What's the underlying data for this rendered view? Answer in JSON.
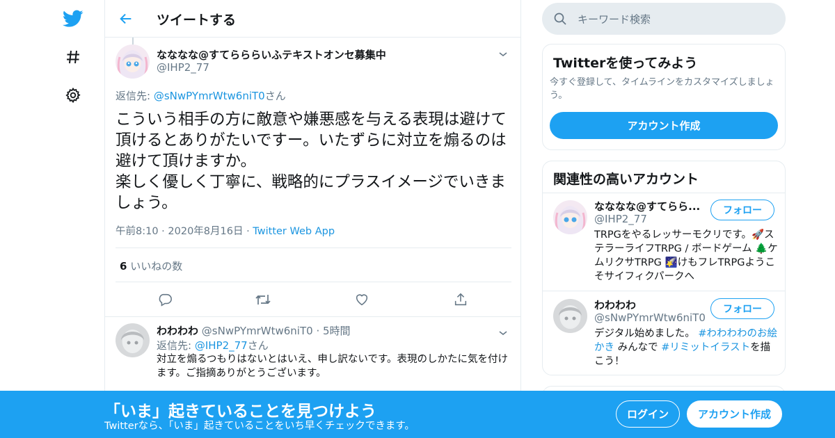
{
  "colors": {
    "brand": "#1da1f2",
    "link": "#1b95e0",
    "muted": "#657786",
    "border": "#e6ecf0"
  },
  "nav": {
    "logo_icon": "twitter-bird-icon",
    "explore_icon": "hashtag-icon",
    "settings_icon": "gear-icon"
  },
  "header": {
    "back_icon": "arrow-left-icon",
    "title": "ツイートする"
  },
  "main_tweet": {
    "author_name": "なななな@すてらららいふテキストオンセ募集中",
    "author_handle": "@IHP2_77",
    "reply_prefix": "返信先: ",
    "reply_mention": "@sNwPYmrWtw6niT0",
    "reply_suffix": "さん",
    "text": "こういう相手の方に敵意や嫌悪感を与える表現は避けて頂けるとありがたいですー。いたずらに対立を煽るのは避けて頂けますか。\n楽しく優しく丁寧に、戦略的にプラスイメージでいきましょう。",
    "time": "午前8:10",
    "date": "2020年8月16日",
    "sep": " · ",
    "source": "Twitter Web App",
    "likes_count": "6",
    "likes_label": " いいねの数",
    "actions": [
      "reply-icon",
      "retweet-icon",
      "like-icon",
      "share-icon"
    ]
  },
  "reply_tweet": {
    "author_name": "わわわわ",
    "author_handle": "@sNwPYmrWtw6niT0",
    "age": "5時間",
    "sep": " · ",
    "reply_prefix": "返信先: ",
    "reply_mention": "@IHP2_77",
    "reply_suffix": "さん",
    "text": "対立を煽るつもりはないとはいえ、申し訳ないです。表現のしかたに気を付けます。ご指摘ありがとうございます。"
  },
  "search": {
    "placeholder": "キーワード検索"
  },
  "signup_card": {
    "title": "Twitterを使ってみよう",
    "description": "今すぐ登録して、タイムラインをカスタマイズしましょう。",
    "button": "アカウント作成"
  },
  "related_card": {
    "title": "関連性の高いアカウント",
    "follow_label": "フォロー",
    "accounts": [
      {
        "name": "なななな@すてらら...",
        "handle": "@IHP2_77",
        "bio": "TRPGをやるレッサーモクリです。🚀ステラーライフTRPG / ボードゲーム 🌲ケムリクサTRPG 🌠けもフレTRPGようこそサイフィクパークへ"
      },
      {
        "name": "わわわわ",
        "handle": "@sNwPYmrWtw6niT0",
        "bio_pre": "デジタル始めました。",
        "bio_link1": "#わわわわのお絵かき",
        "bio_mid": " みんなで ",
        "bio_link2": "#リミットイラスト",
        "bio_post": "を描こう！"
      }
    ]
  },
  "banner": {
    "title": "「いま」起きていることを見つけよう",
    "subtitle": "Twitterなら、「いま」起きていることをいち早くチェックできます。",
    "login": "ログイン",
    "signup": "アカウント作成"
  }
}
